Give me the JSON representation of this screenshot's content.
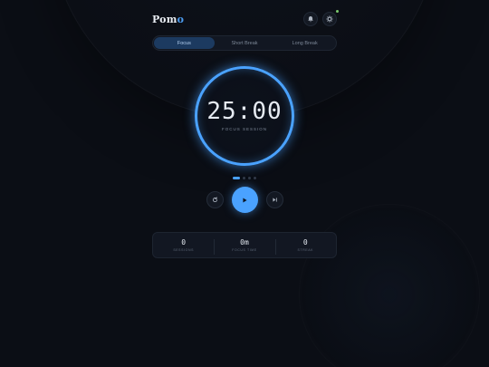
{
  "colors": {
    "background": "#0b0e15",
    "accent": "#4aa2ff",
    "active_tab": "#1c3a60",
    "notification_dot": "#7bc96f"
  },
  "header": {
    "logo_main": "Pom",
    "logo_accent": "o",
    "notification_icon": "bell-icon",
    "settings_icon": "gear-icon"
  },
  "tabs": [
    {
      "label": "Focus",
      "active": true
    },
    {
      "label": "Short Break",
      "active": false
    },
    {
      "label": "Long Break",
      "active": false
    }
  ],
  "timer": {
    "time": "25:00",
    "label": "FOCUS SESSION"
  },
  "session_dots": {
    "total": 4,
    "current": 1
  },
  "controls": {
    "reset_icon": "reset-icon",
    "play_icon": "play-icon",
    "skip_icon": "skip-icon"
  },
  "stats": [
    {
      "value": "0",
      "label": "SESSIONS"
    },
    {
      "value": "0m",
      "label": "FOCUS TIME"
    },
    {
      "value": "0",
      "label": "STREAK"
    }
  ]
}
